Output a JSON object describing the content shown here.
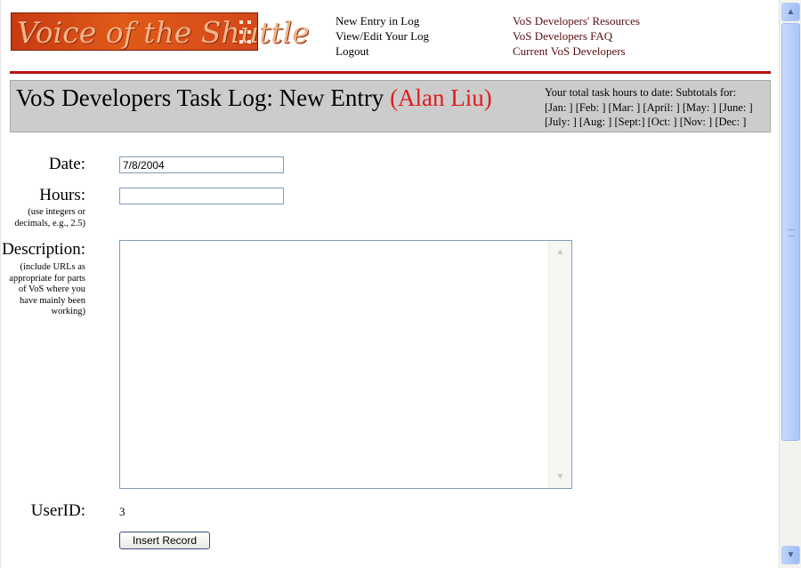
{
  "logo": {
    "text": "Voice of the Shuttle"
  },
  "nav": {
    "left": [
      "New Entry in Log",
      "View/Edit Your Log",
      "Logout"
    ],
    "right": [
      "VoS Developers' Resources",
      "VoS Developers FAQ",
      "Current VoS Developers"
    ]
  },
  "header": {
    "title": "VoS Developers Task Log: New Entry",
    "user": "(Alan Liu)",
    "hours_intro": "Your total task hours to date: Subtotals for:",
    "months": [
      "[Jan: ]",
      "[Feb: ]",
      "[Mar: ]",
      "[April: ]",
      "[May: ]",
      "[June: ]",
      "[July: ]",
      "[Aug: ]",
      "[Sept:]",
      "[Oct: ]",
      "[Nov: ]",
      "[Dec: ]"
    ]
  },
  "form": {
    "date_label": "Date:",
    "date_value": "7/8/2004",
    "hours_label": "Hours:",
    "hours_hint": "(use integers or decimals, e.g., 2.5)",
    "hours_value": "",
    "description_label": "Description:",
    "description_hint": "(include URLs as appropriate for parts of VoS where you have mainly been working)",
    "description_value": "",
    "userid_label": "UserID:",
    "userid_value": "3",
    "submit_label": "Insert Record"
  },
  "colors": {
    "accent_red": "#b31212",
    "user_red": "#e01c1c",
    "band_gray": "#cccccc"
  }
}
